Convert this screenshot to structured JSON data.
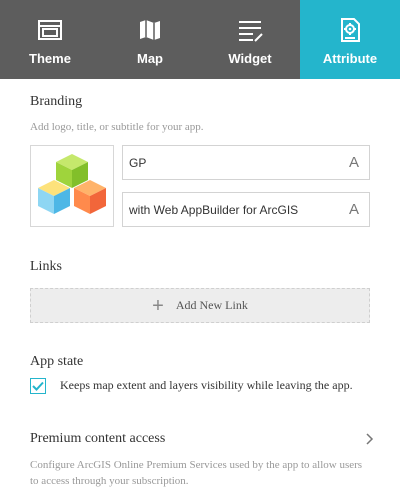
{
  "tabs": [
    {
      "label": "Theme",
      "icon": "theme-icon",
      "active": false
    },
    {
      "label": "Map",
      "icon": "map-icon",
      "active": false
    },
    {
      "label": "Widget",
      "icon": "widget-icon",
      "active": false
    },
    {
      "label": "Attribute",
      "icon": "attribute-icon",
      "active": true
    }
  ],
  "branding": {
    "title": "Branding",
    "description": "Add logo, title, or subtitle for your app.",
    "logo_icon": "app-logo-cubes-icon",
    "title_value": "GP",
    "subtitle_value": "with Web AppBuilder for ArcGIS",
    "font_button": "A"
  },
  "links": {
    "title": "Links",
    "add_icon": "plus-icon",
    "add_label": "Add New Link"
  },
  "app_state": {
    "title": "App state",
    "checked": true,
    "checkbox_label": "Keeps map extent and layers visibility while leaving the app."
  },
  "premium": {
    "title": "Premium content access",
    "description": "Configure ArcGIS Online Premium Services used by the app to allow users to access through your subscription."
  },
  "colors": {
    "tabbar_bg": "#5d5d5d",
    "accent": "#24b5cc"
  }
}
